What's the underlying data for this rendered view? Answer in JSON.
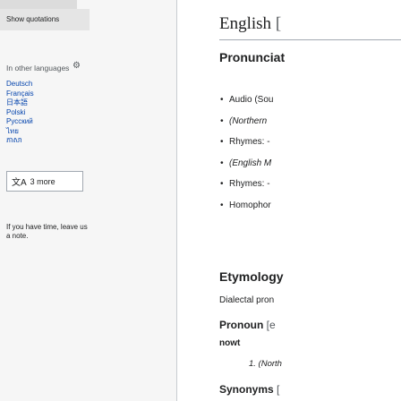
{
  "sidebar": {
    "show_quotations": "Show quotations",
    "languages_header": "In other languages",
    "languages": [
      "Deutsch",
      "Français",
      "日本語",
      "Polski",
      "Русский",
      "ไทย",
      "ភាសា"
    ],
    "more_button": "3 more",
    "translate_glyph": "文A",
    "note": "If you have time, leave us a note."
  },
  "article": {
    "heading": "English",
    "heading_edit": "[",
    "pronunciation_heading": "Pronunciat",
    "pronunciation_items": [
      {
        "text": "Audio (Sou",
        "italic": false
      },
      {
        "text": "(Northern",
        "italic": true
      },
      {
        "text": "Rhymes: -",
        "italic": false
      },
      {
        "text": "(English M",
        "italic": true
      },
      {
        "text": "Rhymes: -",
        "italic": false
      },
      {
        "text": "Homophor",
        "italic": false
      }
    ],
    "etymology_heading": "Etymology",
    "dialectal": "Dialectal pron",
    "pronoun_heading": "Pronoun",
    "pronoun_edit": "[e",
    "headword": "nowt",
    "definition": "1. (North",
    "synonyms_heading": "Synonyms",
    "synonyms_edit": "["
  }
}
